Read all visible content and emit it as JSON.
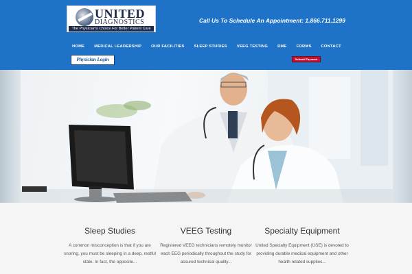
{
  "header": {
    "logo": {
      "name": "UNITED",
      "sub": "DIAGNOSTICS",
      "tagline": "The Physician's Choice For Better Patient Care"
    },
    "callout": "Call Us To Schedule An Appointment: 1.866.711.1299",
    "nav": [
      {
        "label": "HOME"
      },
      {
        "label": "MEDICAL LEADERSHIP"
      },
      {
        "label": "OUR FACILITIES"
      },
      {
        "label": "SLEEP STUDIES"
      },
      {
        "label": "VEEG TESTING"
      },
      {
        "label": "DME"
      },
      {
        "label": "FORMS"
      },
      {
        "label": "CONTACT"
      }
    ],
    "login_label": "Physician Login",
    "payment_label": "Submit Payment"
  },
  "features": [
    {
      "title": "Sleep Studies",
      "text": "A common misconception is that if you are snoring, you must be sleeping in a deep, restful state. In fact, the opposite..."
    },
    {
      "title": "VEEG Testing",
      "text": "Registered VEEG technicians remotely monitor each EEG periodically throughout the study for assured technical quality..."
    },
    {
      "title": "Specialty Equipment",
      "text": "United Specialty Equipment (USE) is devoted to providing durable medical equipment and other health related supplies..."
    }
  ],
  "colors": {
    "header_bg": "#1e73c8",
    "payment_btn": "#c8102e",
    "hero_divider": "#2a2a2a"
  }
}
